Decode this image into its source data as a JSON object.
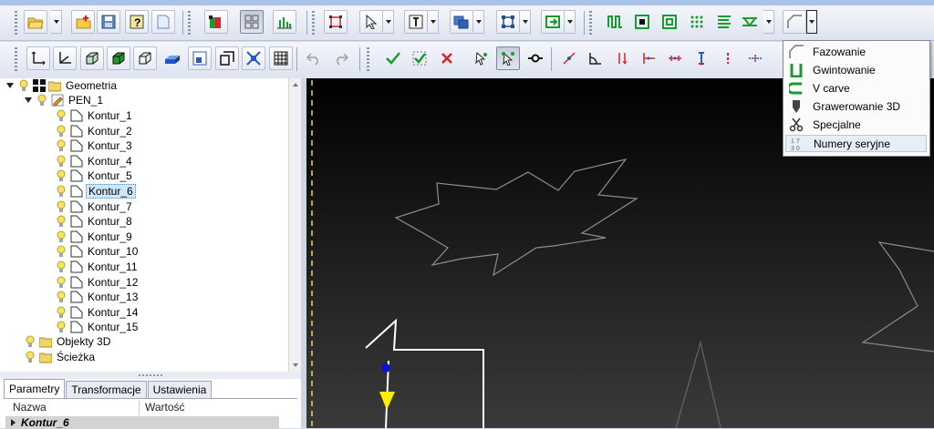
{
  "tree": {
    "root": "Geometria",
    "group": "PEN_1",
    "items": [
      "Kontur_1",
      "Kontur_2",
      "Kontur_3",
      "Kontur_4",
      "Kontur_5",
      "Kontur_6",
      "Kontur_7",
      "Kontur_8",
      "Kontur_9",
      "Kontur_10",
      "Kontur_11",
      "Kontur_12",
      "Kontur_13",
      "Kontur_14",
      "Kontur_15"
    ],
    "selected": "Kontur_6",
    "objects3d": "Objekty 3D",
    "path": "Ścieżka"
  },
  "panel": {
    "tabs": [
      "Parametry",
      "Transformacje",
      "Ustawienia"
    ],
    "active_tab": "Parametry",
    "col_name": "Nazwa",
    "col_value": "Wartość",
    "group_row": "Kontur_6"
  },
  "menu": {
    "items": [
      "Fazowanie",
      "Gwintowanie",
      "V carve",
      "Grawerowanie 3D",
      "Specjalne",
      "Numery seryjne"
    ],
    "highlighted": "Numery seryjne"
  },
  "colors": {
    "accent_green": "#1b9a2e",
    "selection": "#cfe6fb",
    "toolpath_yellow": "#ffee00",
    "start_point_blue": "#1010d0"
  }
}
